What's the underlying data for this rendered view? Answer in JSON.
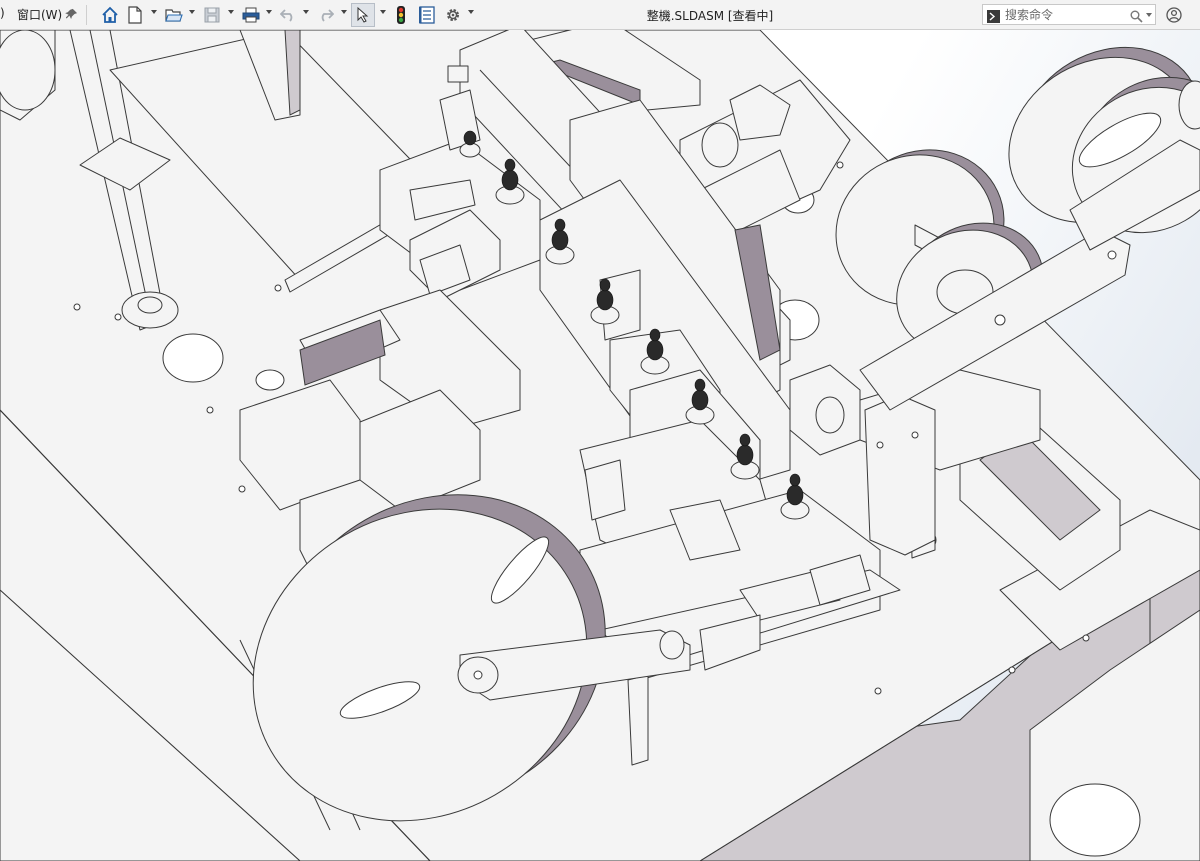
{
  "menu": {
    "partial_left": ")",
    "window_label": "窗口(W)"
  },
  "document": {
    "title": "整機.SLDASM [查看中]"
  },
  "search": {
    "placeholder": "搜索命令"
  },
  "icons": {
    "pin": "pin-icon",
    "home": "home-icon",
    "new": "new-document-icon",
    "open": "open-folder-icon",
    "save": "save-icon",
    "print": "print-icon",
    "undo": "undo-icon",
    "redo": "redo-icon",
    "select": "select-arrow-icon",
    "rebuild": "rebuild-traffic-light-icon",
    "file_properties": "file-properties-icon",
    "options": "options-gear-icon",
    "command_prompt": "command-prompt-icon",
    "search": "magnifier-icon",
    "user": "user-account-icon"
  },
  "colors": {
    "toolbar_bg": "#f3f3f3",
    "metal_fill": "#f4f4f4",
    "metal_edge": "#3a3a3a",
    "shadow_fill": "#9a8f9b",
    "viewport_bg": "#ffffff",
    "search_border": "#c8c8c8"
  }
}
